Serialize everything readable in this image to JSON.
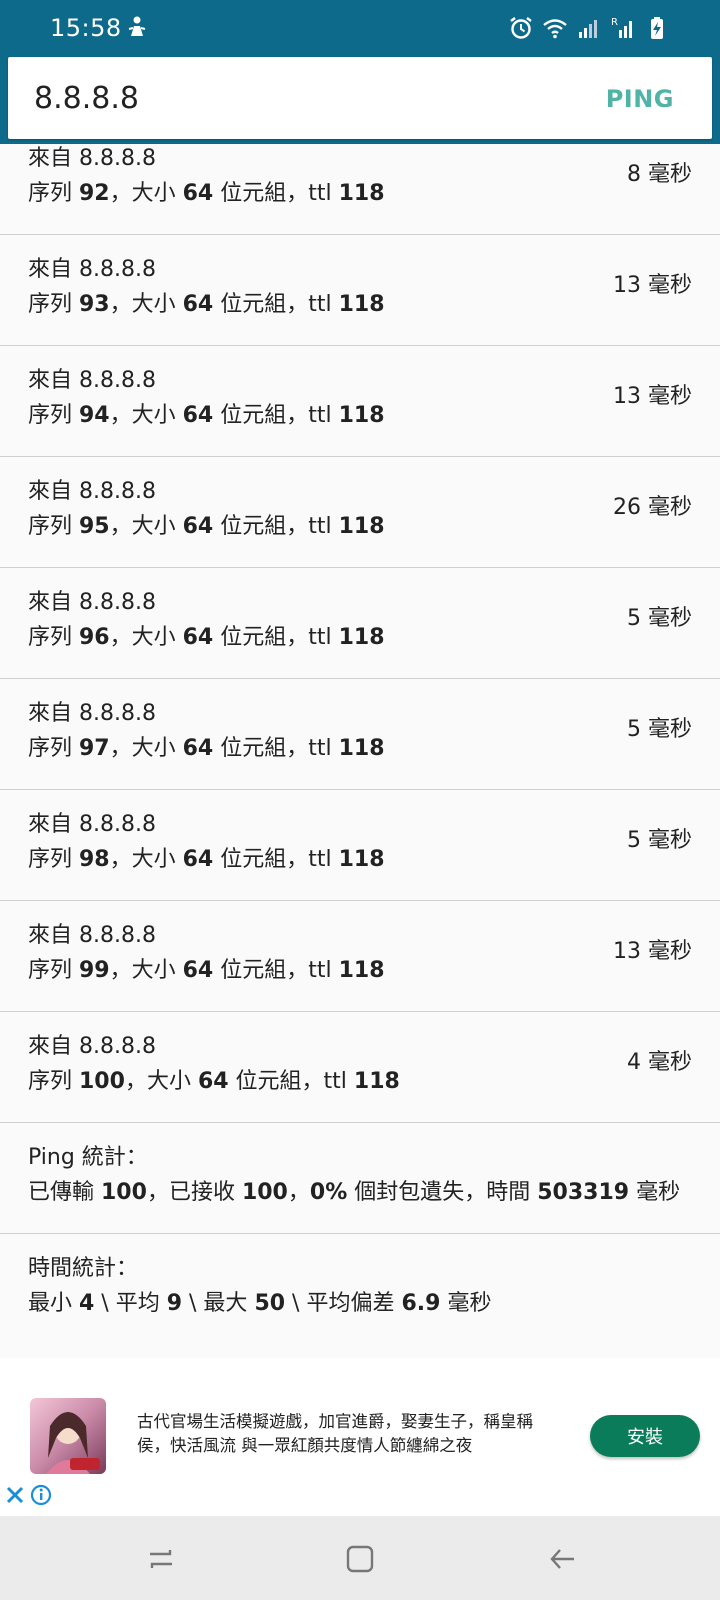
{
  "status_bar": {
    "time": "15:58",
    "icons": [
      "silent-mode-icon",
      "alarm-icon",
      "wifi-icon",
      "signal-icon",
      "roaming-signal-icon",
      "battery-charging-icon"
    ]
  },
  "search": {
    "value": "8.8.8.8",
    "button_label": "PING"
  },
  "results": [
    {
      "from": "來自 8.8.8.8",
      "seq_prefix": "序列 ",
      "seq": "92",
      "seq_mid": "，大小 ",
      "size": "64",
      "size_suffix": " 位元組，ttl ",
      "ttl": "118",
      "time": "8 毫秒"
    },
    {
      "from": "來自 8.8.8.8",
      "seq_prefix": "序列 ",
      "seq": "93",
      "seq_mid": "，大小 ",
      "size": "64",
      "size_suffix": " 位元組，ttl ",
      "ttl": "118",
      "time": "13 毫秒"
    },
    {
      "from": "來自 8.8.8.8",
      "seq_prefix": "序列 ",
      "seq": "94",
      "seq_mid": "，大小 ",
      "size": "64",
      "size_suffix": " 位元組，ttl ",
      "ttl": "118",
      "time": "13 毫秒"
    },
    {
      "from": "來自 8.8.8.8",
      "seq_prefix": "序列 ",
      "seq": "95",
      "seq_mid": "，大小 ",
      "size": "64",
      "size_suffix": " 位元組，ttl ",
      "ttl": "118",
      "time": "26 毫秒"
    },
    {
      "from": "來自 8.8.8.8",
      "seq_prefix": "序列 ",
      "seq": "96",
      "seq_mid": "，大小 ",
      "size": "64",
      "size_suffix": " 位元組，ttl ",
      "ttl": "118",
      "time": "5 毫秒"
    },
    {
      "from": "來自 8.8.8.8",
      "seq_prefix": "序列 ",
      "seq": "97",
      "seq_mid": "，大小 ",
      "size": "64",
      "size_suffix": " 位元組，ttl ",
      "ttl": "118",
      "time": "5 毫秒"
    },
    {
      "from": "來自 8.8.8.8",
      "seq_prefix": "序列 ",
      "seq": "98",
      "seq_mid": "，大小 ",
      "size": "64",
      "size_suffix": " 位元組，ttl ",
      "ttl": "118",
      "time": "5 毫秒"
    },
    {
      "from": "來自 8.8.8.8",
      "seq_prefix": "序列 ",
      "seq": "99",
      "seq_mid": "，大小 ",
      "size": "64",
      "size_suffix": " 位元組，ttl ",
      "ttl": "118",
      "time": "13 毫秒"
    },
    {
      "from": "來自 8.8.8.8",
      "seq_prefix": "序列 ",
      "seq": "100",
      "seq_mid": "，大小 ",
      "size": "64",
      "size_suffix": " 位元組，ttl ",
      "ttl": "118",
      "time": "4 毫秒"
    }
  ],
  "ping_stats": {
    "title": "Ping 統計：",
    "t1": "已傳輸 ",
    "sent": "100",
    "t2": "，已接收 ",
    "received": "100",
    "t3": "，",
    "loss": "0%",
    "t4": " 個封包遺失，時間 ",
    "total_time": "503319",
    "t5": " 毫秒"
  },
  "time_stats": {
    "title": "時間統計：",
    "t1": "最小 ",
    "min": "4",
    "t2": " \\ 平均 ",
    "avg": "9",
    "t3": " \\ 最大 ",
    "max": "50",
    "t4": " \\ 平均偏差 ",
    "mdev": "6.9",
    "t5": " 毫秒"
  },
  "ad": {
    "text": "古代官場生活模擬遊戲，加官進爵，娶妻生子，稱皇稱侯，快活風流 與一眾紅顏共度情人節纏綿之夜",
    "install_label": "安裝",
    "install_color": "#0a7c5a"
  },
  "nav": {
    "buttons": [
      "recent-apps-icon",
      "home-icon",
      "back-icon"
    ]
  },
  "colors": {
    "header": "#0e6a8a",
    "ping_button": "#4fb3a6"
  }
}
